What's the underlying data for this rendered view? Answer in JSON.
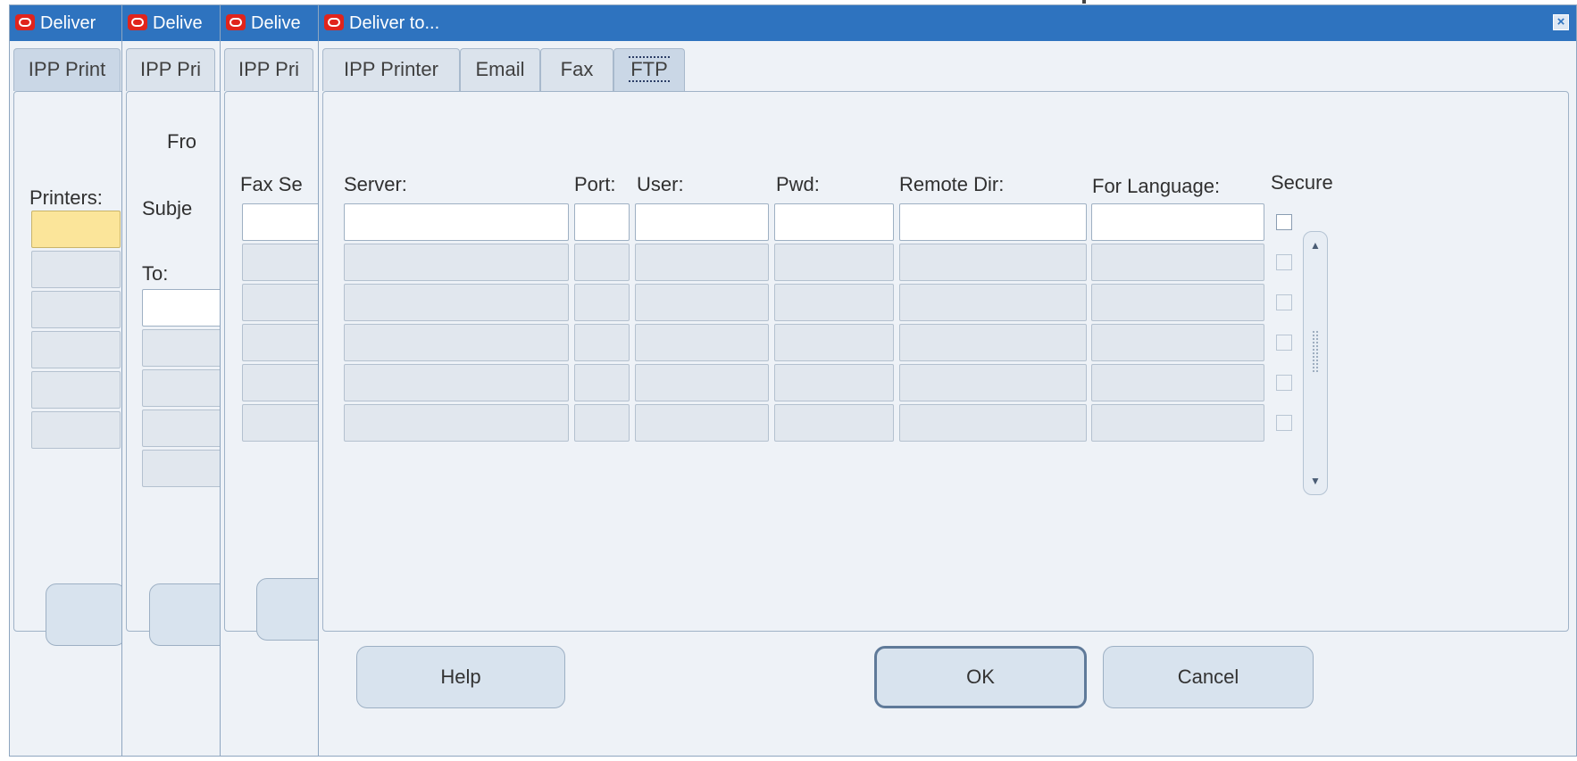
{
  "windows": [
    {
      "title": "Deliver",
      "tab": "IPP Print",
      "label": "Printers:",
      "button": ""
    },
    {
      "title": "Delive",
      "tab": "IPP Pri",
      "labels": {
        "from": "Fro",
        "subject": "Subje",
        "to": "To:"
      },
      "button": ""
    },
    {
      "title": "Delive",
      "tab": "IPP Pri",
      "label": "Fax Se",
      "button": ""
    }
  ],
  "dialog": {
    "title": "Deliver to...",
    "close_glyph": "×",
    "tabs": [
      "IPP Printer",
      "Email",
      "Fax",
      "FTP"
    ],
    "active_tab": "FTP",
    "columns": [
      "Server:",
      "Port:",
      "User:",
      "Pwd:",
      "Remote Dir:",
      "For Language:",
      "Secure"
    ],
    "rows": [
      {
        "server": "",
        "port": "",
        "user": "",
        "pwd": "",
        "remote_dir": "",
        "language": "",
        "secure": false
      },
      {
        "server": "",
        "port": "",
        "user": "",
        "pwd": "",
        "remote_dir": "",
        "language": "",
        "secure": false
      },
      {
        "server": "",
        "port": "",
        "user": "",
        "pwd": "",
        "remote_dir": "",
        "language": "",
        "secure": false
      },
      {
        "server": "",
        "port": "",
        "user": "",
        "pwd": "",
        "remote_dir": "",
        "language": "",
        "secure": false
      },
      {
        "server": "",
        "port": "",
        "user": "",
        "pwd": "",
        "remote_dir": "",
        "language": "",
        "secure": false
      },
      {
        "server": "",
        "port": "",
        "user": "",
        "pwd": "",
        "remote_dir": "",
        "language": "",
        "secure": false
      }
    ],
    "buttons": {
      "help": "Help",
      "ok": "OK",
      "cancel": "Cancel"
    },
    "scroll_up_icon": "▲",
    "scroll_down_icon": "▼"
  },
  "colors": {
    "titlebar": "#2e73bf",
    "dialog_bg": "#eef2f7",
    "active_field": "#ffffff",
    "focused_field": "#fbe59a"
  }
}
